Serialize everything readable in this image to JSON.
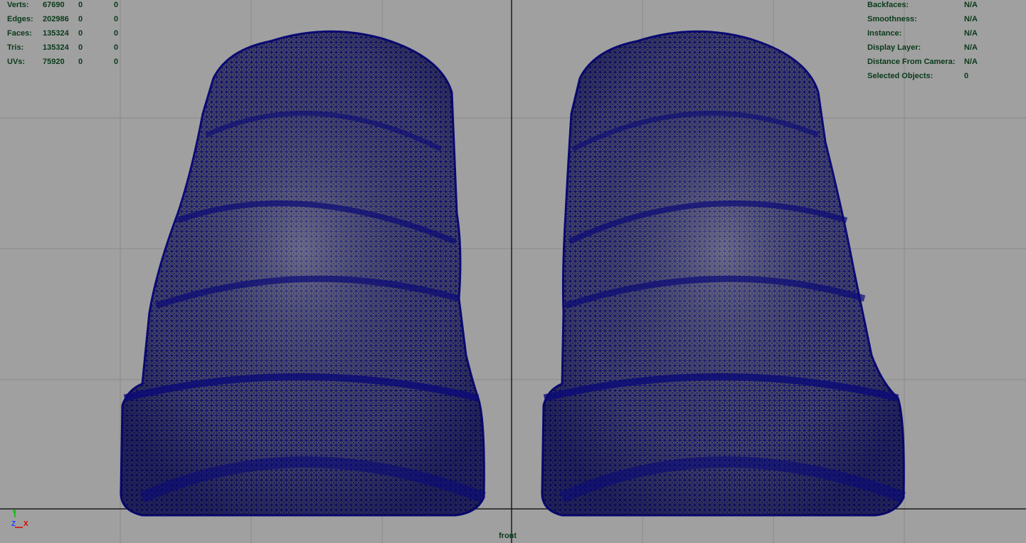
{
  "hud_left": {
    "rows": [
      {
        "label": "Verts:",
        "v1": "67690",
        "v2": "0",
        "v3": "0"
      },
      {
        "label": "Edges:",
        "v1": "202986",
        "v2": "0",
        "v3": "0"
      },
      {
        "label": "Faces:",
        "v1": "135324",
        "v2": "0",
        "v3": "0"
      },
      {
        "label": "Tris:",
        "v1": "135324",
        "v2": "0",
        "v3": "0"
      },
      {
        "label": "UVs:",
        "v1": "75920",
        "v2": "0",
        "v3": "0"
      }
    ]
  },
  "hud_right": {
    "rows": [
      {
        "label": "Backfaces:",
        "value": "N/A"
      },
      {
        "label": "Smoothness:",
        "value": "N/A"
      },
      {
        "label": "Instance:",
        "value": "N/A"
      },
      {
        "label": "Display Layer:",
        "value": "N/A"
      },
      {
        "label": "Distance From Camera:",
        "value": "N/A"
      },
      {
        "label": "Selected Objects:",
        "value": "0"
      }
    ]
  },
  "camera": {
    "name": "front"
  },
  "axis": {
    "y_label": "Y",
    "z_label": "Z",
    "x_label": "X",
    "y_color": "#00c000",
    "z_color": "#2040ff",
    "x_color": "#e00000"
  },
  "colors": {
    "background": "#a0a0a0",
    "grid": "#8a8a8a",
    "wire": "#0a0a78",
    "hud_text": "#0a3a1a"
  }
}
